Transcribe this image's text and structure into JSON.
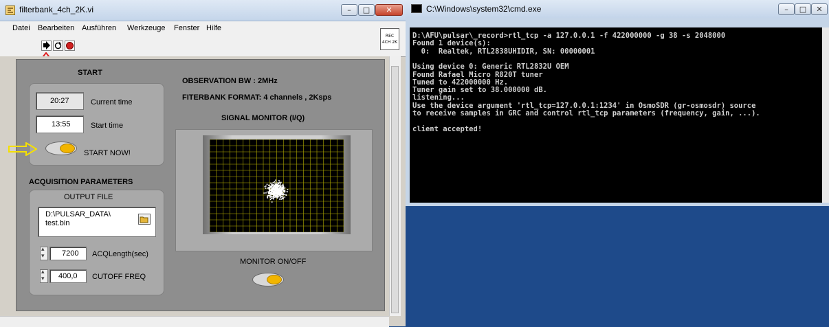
{
  "labview": {
    "title": "filterbank_4ch_2K.vi",
    "menu": [
      "Datei",
      "Bearbeiten",
      "Ausführen",
      "Werkzeuge",
      "Fenster",
      "Hilfe"
    ],
    "rec_badge": [
      "REC",
      "4CH 2K"
    ],
    "start_heading": "START",
    "current_time_value": "20:27",
    "current_time_label": "Current time",
    "start_time_value": "13:55",
    "start_time_label": "Start time",
    "start_now_label": "START NOW!",
    "acq_heading": "ACQUISITION PARAMETERS",
    "output_file_heading": "OUTPUT FILE",
    "output_path_line1": "D:\\PULSAR_DATA\\",
    "output_path_line2": "test.bin",
    "acq_length_value": "7200",
    "acq_length_label": "ACQLength(sec)",
    "cutoff_value": "400,0",
    "cutoff_label": "CUTOFF FREQ",
    "obs_bw": "OBSERVATION BW : 2MHz",
    "filterbank_format": "FITERBANK FORMAT: 4 channels , 2Ksps",
    "signal_monitor": "SIGNAL MONITOR (I/Q)",
    "monitor_toggle": "MONITOR ON/OFF"
  },
  "cmd": {
    "title": "C:\\Windows\\system32\\cmd.exe",
    "lines": [
      "D:\\AFU\\pulsar\\_record>rtl_tcp -a 127.0.0.1 -f 422000000 -g 38 -s 2048000",
      "Found 1 device(s):",
      "  0:  Realtek, RTL2838UHIDIR, SN: 00000001",
      "",
      "Using device 0: Generic RTL2832U OEM",
      "Found Rafael Micro R820T tuner",
      "Tuned to 422000000 Hz.",
      "Tuner gain set to 38.000000 dB.",
      "listening...",
      "Use the device argument 'rtl_tcp=127.0.0.1:1234' in OsmoSDR (gr-osmosdr) source",
      "to receive samples in GRC and control rtl_tcp parameters (frequency, gain, ...).",
      "",
      "client accepted!"
    ]
  },
  "colors": {
    "arrow_red": "#e02020",
    "arrow_yellow": "#f5e000",
    "scope_grid": "#b5b000"
  }
}
